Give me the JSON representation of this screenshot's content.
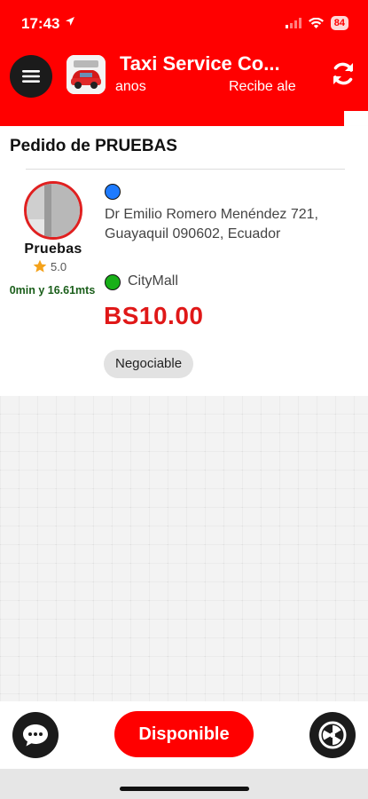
{
  "status_bar": {
    "time": "17:43",
    "battery": "84"
  },
  "app_bar": {
    "title": "Taxi Service Co...",
    "marquee_left": "anos",
    "marquee_right": "Recibe ale"
  },
  "progress": {
    "fraction": 0.935,
    "color": "#ff0000"
  },
  "order": {
    "title": "Pedido de PRUEBAS",
    "user_name": "Pruebas",
    "rating": "5.0",
    "eta": "0min y 16.61mts",
    "origin": "Dr Emilio Romero Menéndez 721, Guayaquil 090602, Ecuador",
    "destination": "CityMall",
    "price": "BS10.00",
    "tag": "Negociable"
  },
  "bottom_bar": {
    "status_button": "Disponible",
    "chat_icon": "chat-bubble-icon",
    "radar_icon": "radar-icon"
  },
  "colors": {
    "brand": "#ff0000",
    "price": "#e01818",
    "eta": "#1a5e1a"
  }
}
